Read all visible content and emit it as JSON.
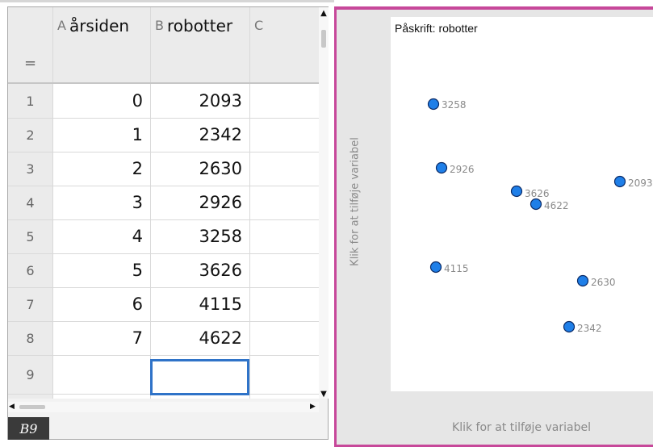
{
  "spreadsheet": {
    "columns": [
      {
        "letter": "A",
        "name": "årsiden"
      },
      {
        "letter": "B",
        "name": "robotter"
      },
      {
        "letter": "C",
        "name": ""
      }
    ],
    "formula_row_label": "=",
    "rows": [
      {
        "num": "1",
        "a": "0",
        "b": "2093"
      },
      {
        "num": "2",
        "a": "1",
        "b": "2342"
      },
      {
        "num": "3",
        "a": "2",
        "b": "2630"
      },
      {
        "num": "4",
        "a": "3",
        "b": "2926"
      },
      {
        "num": "5",
        "a": "4",
        "b": "3258"
      },
      {
        "num": "6",
        "a": "5",
        "b": "3626"
      },
      {
        "num": "7",
        "a": "6",
        "b": "4115"
      },
      {
        "num": "8",
        "a": "7",
        "b": "4622"
      },
      {
        "num": "9",
        "a": "",
        "b": ""
      }
    ],
    "active_cell": "B9"
  },
  "graph": {
    "caption": "Påskrift: robotter",
    "y_axis_hint": "Klik for at tilføje variabel",
    "x_axis_hint": "Klik for at tilføje variabel",
    "point_color": "#1f7fe8",
    "accent_color": "#c7489a",
    "points": [
      {
        "label": "3258"
      },
      {
        "label": "2926"
      },
      {
        "label": "3626"
      },
      {
        "label": "4622"
      },
      {
        "label": "2093"
      },
      {
        "label": "4115"
      },
      {
        "label": "2630"
      },
      {
        "label": "2342"
      }
    ]
  }
}
